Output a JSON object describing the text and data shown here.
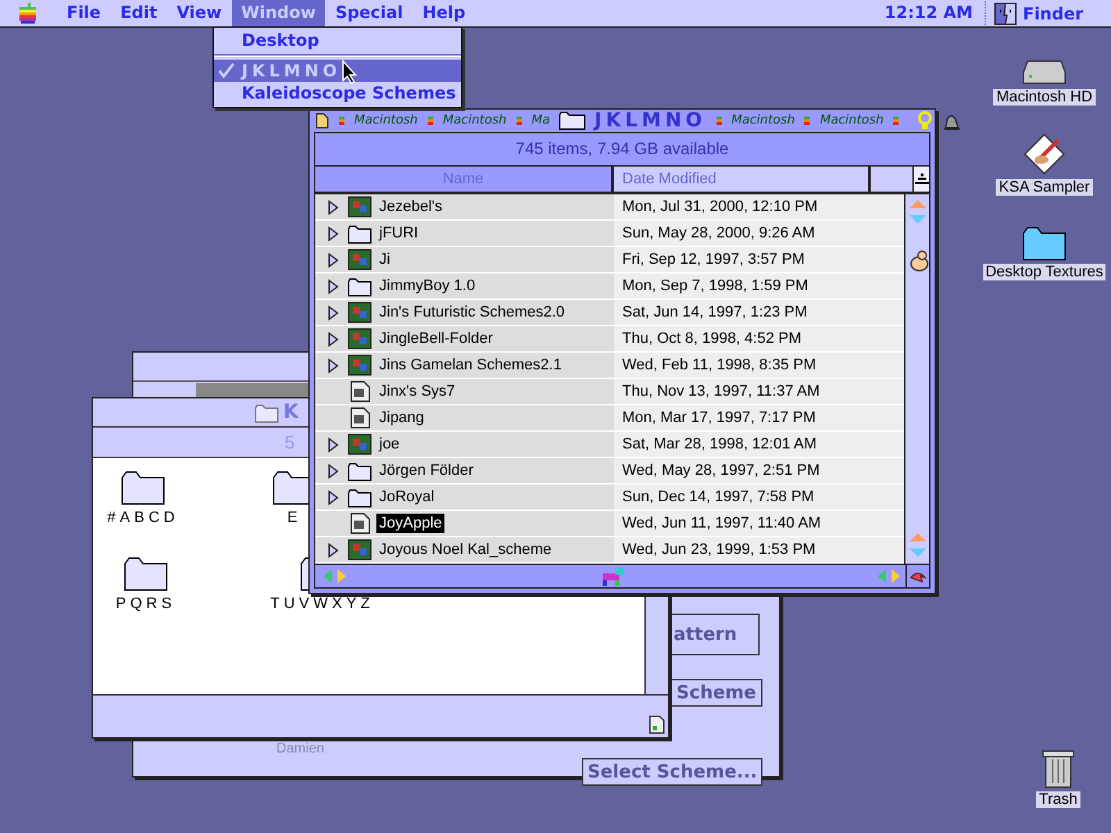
{
  "menu_bar": {
    "menus": [
      {
        "label": "File",
        "selected": false
      },
      {
        "label": "Edit",
        "selected": false
      },
      {
        "label": "View",
        "selected": false
      },
      {
        "label": "Window",
        "selected": true
      },
      {
        "label": "Special",
        "selected": false
      },
      {
        "label": "Help",
        "selected": false
      }
    ],
    "clock": "12:12 AM",
    "app": "Finder"
  },
  "window_menu": {
    "items": [
      {
        "kind": "item",
        "label": "Desktop",
        "checked": false,
        "selected": false
      },
      {
        "kind": "separator"
      },
      {
        "kind": "item",
        "label": "JKLMNO",
        "checked": true,
        "selected": true
      },
      {
        "kind": "item",
        "label": "Kaleidoscope Schemes",
        "checked": false,
        "selected": false
      }
    ]
  },
  "scheme_dialog": {
    "buttons": [
      "attern",
      "Scheme",
      "Select Scheme..."
    ],
    "footer": "Damien"
  },
  "folder_window": {
    "title": "K",
    "info": "5",
    "items": [
      {
        "label": "#ABCD"
      },
      {
        "label": "E"
      },
      {
        "label": "PQRS"
      },
      {
        "label": "TUVWXYZ"
      }
    ]
  },
  "finder_window": {
    "title": "JKLMNO",
    "title_pattern_left": [
      "Macintosh",
      "Macintosh",
      "Ma"
    ],
    "title_pattern_right": [
      "Macintosh",
      "Macintosh"
    ],
    "info": "745 items, 7.94 GB available",
    "columns": [
      {
        "label": "Name",
        "selected": true
      },
      {
        "label": "Date Modified",
        "selected": false
      }
    ],
    "rows": [
      {
        "kind": "custom-folder",
        "name": "Jezebel's",
        "date": "Mon, Jul 31, 2000, 12:10 PM",
        "selected": false
      },
      {
        "kind": "folder",
        "name": "jFURI",
        "date": "Sun, May 28, 2000, 9:26 AM",
        "selected": false
      },
      {
        "kind": "custom-folder",
        "name": "Ji",
        "date": "Fri, Sep 12, 1997, 3:57 PM",
        "selected": false
      },
      {
        "kind": "folder",
        "name": "JimmyBoy 1.0",
        "date": "Mon, Sep 7, 1998, 1:59 PM",
        "selected": false
      },
      {
        "kind": "custom-folder",
        "name": "Jin's Futuristic Schemes2.0",
        "date": "Sat, Jun 14, 1997, 1:23 PM",
        "selected": false
      },
      {
        "kind": "custom-folder",
        "name": "JingleBell-Folder",
        "date": "Thu, Oct 8, 1998, 4:52 PM",
        "selected": false
      },
      {
        "kind": "custom-folder",
        "name": "Jins Gamelan Schemes2.1",
        "date": "Wed, Feb 11, 1998, 8:35 PM",
        "selected": false
      },
      {
        "kind": "document",
        "name": "Jinx's Sys7",
        "date": "Thu, Nov 13, 1997, 11:37 AM",
        "selected": false
      },
      {
        "kind": "document",
        "name": "Jipang",
        "date": "Mon, Mar 17, 1997, 7:17 PM",
        "selected": false
      },
      {
        "kind": "custom-folder",
        "name": "joe",
        "date": "Sat, Mar 28, 1998, 12:01 AM",
        "selected": false
      },
      {
        "kind": "folder",
        "name": "Jörgen Földer",
        "date": "Wed, May 28, 1997, 2:51 PM",
        "selected": false
      },
      {
        "kind": "folder",
        "name": "JoRoyal",
        "date": "Sun, Dec 14, 1997, 7:58 PM",
        "selected": false
      },
      {
        "kind": "document",
        "name": "JoyApple",
        "date": "Wed, Jun 11, 1997, 11:40 AM",
        "selected": true
      },
      {
        "kind": "custom-folder",
        "name": "Joyous Noel Kal_scheme",
        "date": "Wed, Jun 23, 1999, 1:53 PM",
        "selected": false
      }
    ]
  },
  "desktop_icons": [
    {
      "kind": "disk",
      "label": "Macintosh HD"
    },
    {
      "kind": "application",
      "label": "KSA Sampler"
    },
    {
      "kind": "folder",
      "label": "Desktop Textures"
    },
    {
      "kind": "trash",
      "label": "Trash"
    }
  ]
}
